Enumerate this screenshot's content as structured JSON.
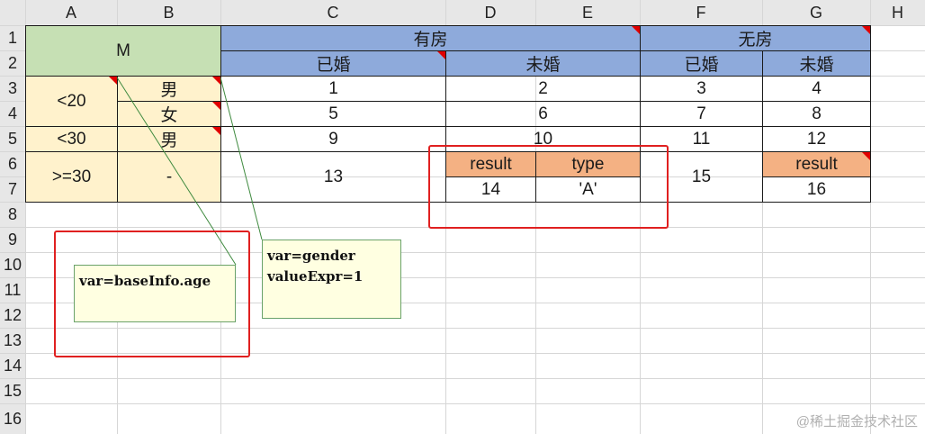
{
  "columns": [
    "A",
    "B",
    "C",
    "D",
    "E",
    "F",
    "G",
    "H"
  ],
  "rows": [
    "1",
    "2",
    "3",
    "4",
    "5",
    "6",
    "7",
    "8",
    "9",
    "10",
    "11",
    "12",
    "13",
    "14",
    "15",
    "16"
  ],
  "cells": {
    "m": "M",
    "has_house": "有房",
    "no_house": "无房",
    "married_c": "已婚",
    "unmarried_de": "未婚",
    "married_f": "已婚",
    "unmarried_g": "未婚",
    "age_lt20": "<20",
    "male_3": "男",
    "female_4": "女",
    "age_lt30": "<30",
    "male_5": "男",
    "age_ge30": ">=30",
    "dash": "-",
    "c3": "1",
    "de3": "2",
    "f3": "3",
    "g3": "4",
    "c4": "5",
    "de4": "6",
    "f4": "7",
    "g4": "8",
    "c5": "9",
    "de5": "10",
    "f5": "11",
    "g5": "12",
    "c67": "13",
    "d6": "result",
    "e6": "type",
    "d7": "14",
    "e7": "'A'",
    "f67": "15",
    "g6": "result",
    "g7": "16"
  },
  "comments": {
    "age": "var=baseInfo.age",
    "gender": "var=gender\nvalueExpr=1"
  },
  "watermark": "@稀土掘金技术社区",
  "colors": {
    "green_header": "#c6e0b4",
    "blue_header": "#8eaadb",
    "yellow_fill": "#fff2cc",
    "orange_fill": "#f4b183",
    "red_box": "#e02020",
    "comment_bg": "#ffffe1"
  }
}
